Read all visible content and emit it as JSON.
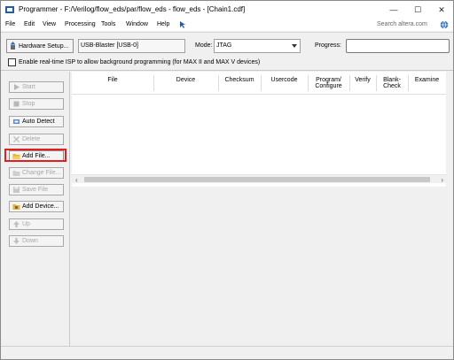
{
  "window": {
    "title": "Programmer - F:/Verilog/flow_eds/par/flow_eds - flow_eds - [Chain1.cdf]",
    "minimize_glyph": "—",
    "maximize_glyph": "☐",
    "close_glyph": "✕"
  },
  "menubar": {
    "items": [
      "File",
      "Edit",
      "View",
      "Processing",
      "Tools",
      "Window",
      "Help"
    ],
    "search_placeholder": "Search altera.com"
  },
  "toolbar": {
    "hardware_setup_label": "Hardware Setup...",
    "hardware_value": "USB-Blaster [USB-0]",
    "mode_label": "Mode:",
    "mode_value": "JTAG",
    "progress_label": "Progress:",
    "progress_value": "",
    "realtime_isp_label": "Enable real-time ISP to allow background programming (for MAX II and MAX V devices)",
    "realtime_isp_checked": false
  },
  "sidebar": {
    "buttons": [
      {
        "label": "Start",
        "enabled": false
      },
      {
        "label": "Stop",
        "enabled": false
      },
      {
        "label": "Auto Detect",
        "enabled": true
      },
      {
        "label": "Delete",
        "enabled": false
      },
      {
        "label": "Add File...",
        "enabled": true,
        "highlighted": true
      },
      {
        "label": "Change File...",
        "enabled": false
      },
      {
        "label": "Save File",
        "enabled": false
      },
      {
        "label": "Add Device...",
        "enabled": true
      },
      {
        "label": "Up",
        "enabled": false
      },
      {
        "label": "Down",
        "enabled": false
      }
    ]
  },
  "table": {
    "columns": [
      "File",
      "Device",
      "Checksum",
      "Usercode",
      "Program/\nConfigure",
      "Verify",
      "Blank-\nCheck",
      "Examine"
    ],
    "rows": []
  },
  "colors": {
    "highlight_border": "#e41e1e",
    "window_bg": "#f0f0f0"
  }
}
